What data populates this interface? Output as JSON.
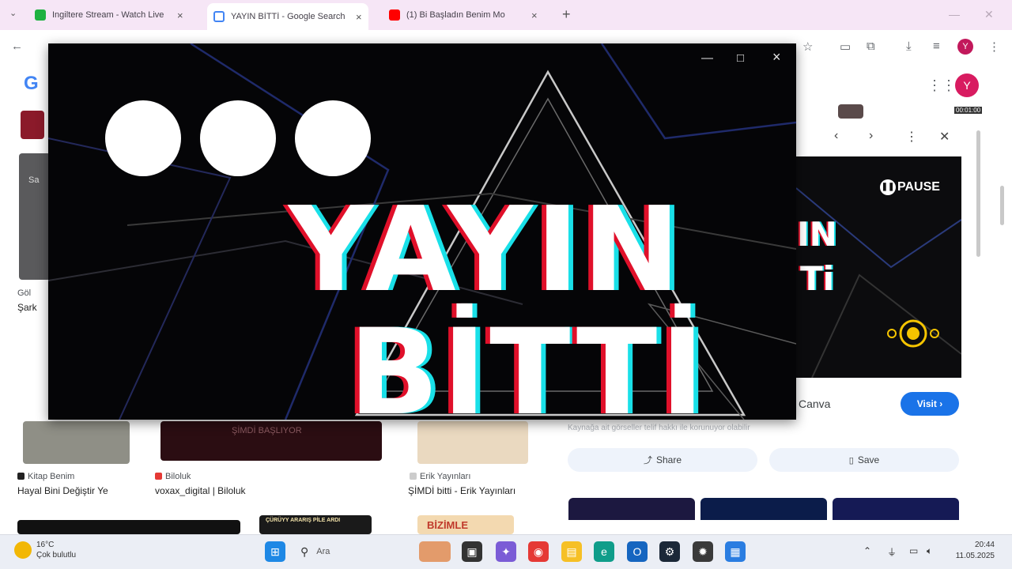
{
  "browser": {
    "tabs": [
      {
        "title": "Ingiltere Stream - Watch Live",
        "favicon_color": "#1fb141",
        "active": false
      },
      {
        "title": "YAYIN BİTTİ - Google Search",
        "favicon_color": "#4285f4",
        "active": true
      },
      {
        "title": "(1) Bi Başladın Benim Mo",
        "favicon_color": "#ff0000",
        "active": false
      }
    ],
    "close_glyph": "×",
    "new_tab_glyph": "+",
    "back_glyph": "←",
    "profile_initial": "Y"
  },
  "google": {
    "logo": "G",
    "avatar_initial": "Y",
    "results": [
      {
        "source": "Kitap Benim",
        "title": "Hayal Bini Değiştir Ye",
        "source_color": "#222222"
      },
      {
        "source": "Biloluk",
        "title": "voxax_digital | Biloluk",
        "source_color": "#e53935"
      },
      {
        "source": "Erik Yayınları",
        "title": "ŞİMDİ bitti - Erik Yayınları",
        "source_color": "#aaaaaa"
      }
    ],
    "thumb_texts": {
      "dark_banner": "ŞİMDİ BAŞLIYOR",
      "bottom_banner": "BİZİMLE",
      "bottom_small": "ÇÜRÜYY ARARIŞ PİLE ARDI"
    },
    "left_snips": [
      "Sa",
      "Göl",
      "Şark"
    ],
    "preview": {
      "pause_label": "PAUSE",
      "side_text_line1": "IN",
      "side_text_line2": "Ti",
      "source": "Canva",
      "visit_label": "Visit ›",
      "caption": "Kaynağa ait görseller telif hakkı ile korunuyor olabilir",
      "share_label": "Share",
      "save_label": "Save",
      "timestamp": "00:01:00"
    }
  },
  "pip": {
    "line1": "YAYIN",
    "line2": "BİTTİ",
    "controls": {
      "minimize": "—",
      "maximize": "□",
      "close": "×"
    }
  },
  "taskbar": {
    "weather_temp": "16°C",
    "weather_desc": "Çok bulutlu",
    "search_placeholder": "Ara",
    "clock_time": "20:44",
    "clock_date": "11.05.2025"
  }
}
